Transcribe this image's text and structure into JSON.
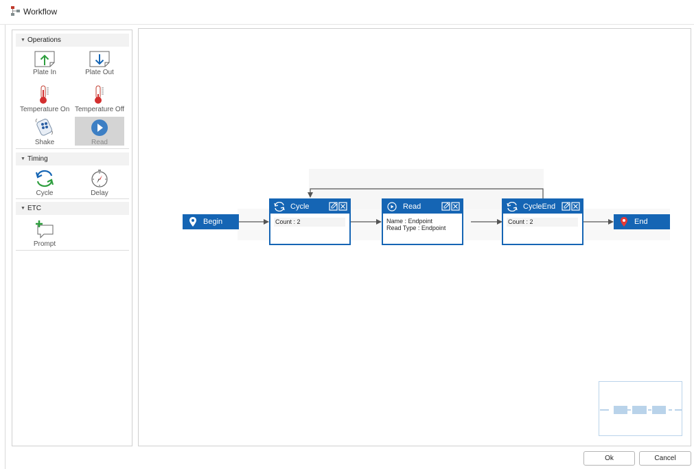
{
  "window": {
    "title": "Workflow"
  },
  "palette": {
    "sections": [
      {
        "title": "Operations",
        "tools": [
          {
            "label": "Plate In",
            "icon": "plate-in-icon"
          },
          {
            "label": "Plate Out",
            "icon": "plate-out-icon"
          },
          {
            "label": "Temperature On",
            "icon": "thermometer-icon"
          },
          {
            "label": "Temperature Off",
            "icon": "thermometer-icon"
          },
          {
            "label": "Shake",
            "icon": "shake-icon"
          },
          {
            "label": "Read",
            "icon": "play-icon",
            "selected": true
          }
        ]
      },
      {
        "title": "Timing",
        "tools": [
          {
            "label": "Cycle",
            "icon": "cycle-icon"
          },
          {
            "label": "Delay",
            "icon": "stopwatch-icon"
          }
        ]
      },
      {
        "title": "ETC",
        "tools": [
          {
            "label": "Prompt",
            "icon": "prompt-icon"
          }
        ]
      }
    ]
  },
  "canvas": {
    "begin": {
      "label": "Begin",
      "icon": "location-pin-icon"
    },
    "end": {
      "label": "End",
      "icon": "location-pin-icon"
    },
    "nodes": [
      {
        "title": "Cycle",
        "icon": "cycle-icon",
        "lines": [
          "Count : 2"
        ]
      },
      {
        "title": "Read",
        "icon": "play-icon",
        "lines": [
          "Name : Endpoint",
          "Read Type : Endpoint"
        ]
      },
      {
        "title": "CycleEnd",
        "icon": "cycle-icon",
        "lines": [
          "Count : 2"
        ]
      }
    ]
  },
  "buttons": {
    "ok": "Ok",
    "cancel": "Cancel"
  },
  "colors": {
    "node_blue": "#1565b4",
    "arrow_green": "#2e9e3e",
    "thermo_red": "#d32f2f",
    "pin_red": "#e53935",
    "minimap_block": "#b9d3ea"
  }
}
